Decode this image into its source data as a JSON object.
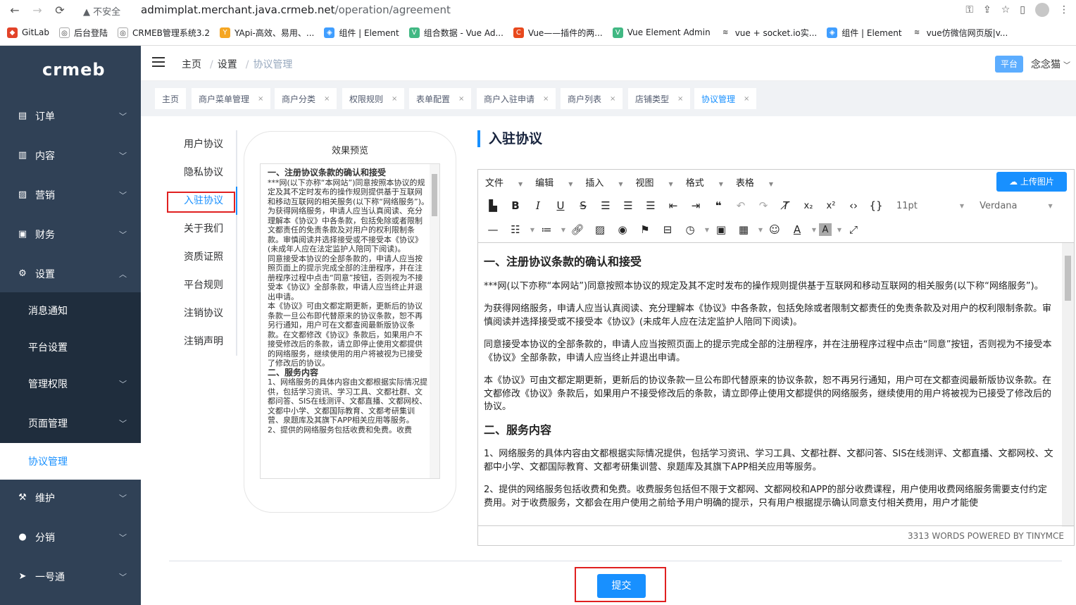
{
  "browser": {
    "insecure_label": "不安全",
    "url_host": "admimplat.merchant.java.crmeb.net",
    "url_path": "/operation/agreement",
    "bookmarks": [
      "GitLab",
      "后台登陆",
      "CRMEB管理系统3.2",
      "YApi-高效、易用、...",
      "组件 | Element",
      "组合数据 - Vue Ad...",
      "Vue——插件的两...",
      "Vue Element Admin",
      "vue + socket.io实...",
      "组件 | Element",
      "vue仿微信网页版|v..."
    ]
  },
  "sidebar": {
    "logo": "crmeb",
    "items": [
      {
        "label": "订单"
      },
      {
        "label": "内容"
      },
      {
        "label": "营销"
      },
      {
        "label": "财务"
      },
      {
        "label": "设置"
      },
      {
        "label": "维护"
      },
      {
        "label": "分销"
      },
      {
        "label": "一号通"
      }
    ],
    "sub_items": [
      {
        "label": "消息通知"
      },
      {
        "label": "平台设置"
      },
      {
        "label": "管理权限"
      },
      {
        "label": "页面管理"
      },
      {
        "label": "协议管理"
      }
    ]
  },
  "header": {
    "breadcrumb": [
      "主页",
      "设置",
      "协议管理"
    ],
    "platform_badge": "平台",
    "username": "念念猫"
  },
  "tabs": [
    "主页",
    "商户菜单管理",
    "商户分类",
    "权限规则",
    "表单配置",
    "商户入驻申请",
    "商户列表",
    "店铺类型",
    "协议管理"
  ],
  "agreement_tabs": [
    "用户协议",
    "隐私协议",
    "入驻协议",
    "关于我们",
    "资质证照",
    "平台规则",
    "注销协议",
    "注销声明"
  ],
  "preview": {
    "title": "效果预览",
    "h1": "一、注册协议条款的确认和接受",
    "p1": "***网(以下亦称“本网站”)同意按照本协议的规定及其不定时发布的操作规则提供基于互联网和移动互联网的相关服务(以下称“网络服务”)。",
    "p2": "为获得网络服务，申请人应当认真阅读、充分理解本《协议》中各条款，包括免除或者限制文都责任的免责条款及对用户的权利限制条款。审慎阅读并选择接受或不接受本《协议》(未成年人应在法定监护人陪同下阅读)。",
    "p3": "同意接受本协议的全部条款的，申请人应当按照页面上的提示完成全部的注册程序，并在注册程序过程中点击“同意”按钮，否则视为不接受本《协议》全部条款，申请人应当终止并退出申请。",
    "p4": "本《协议》可由文都定期更新，更新后的协议条款一旦公布即代替原来的协议条款，恕不再另行通知，用户可在文都查阅最新版协议条款。在文都修改《协议》条款后，如果用户不接受修改后的条款，请立即停止使用文都提供的网络服务，继续使用的用户将被视为已接受了修改后的协议。",
    "h2": "二、服务内容",
    "p5": "1、网络服务的具体内容由文都根据实际情况提供，包括学习资讯、学习工具、文都社群、文都问答、SIS在线测评、文都直播、文都网校、文都中小学、文都国际教育、文都考研集训营、泉题库及其旗下APP相关应用等服务。",
    "p6": "2、提供的网络服务包括收费和免费。收费"
  },
  "editor": {
    "title": "入驻协议",
    "menus": [
      "文件",
      "编辑",
      "插入",
      "视图",
      "格式",
      "表格"
    ],
    "upload_label": "上传图片",
    "font_size": "11pt",
    "font_family": "Verdana",
    "h1": "一、注册协议条款的确认和接受",
    "p1": "***网(以下亦称“本网站”)同意按照本协议的规定及其不定时发布的操作规则提供基于互联网和移动互联网的相关服务(以下称“网络服务”)。",
    "p2": "为获得网络服务，申请人应当认真阅读、充分理解本《协议》中各条款，包括免除或者限制文都责任的免责条款及对用户的权利限制条款。审慎阅读并选择接受或不接受本《协议》(未成年人应在法定监护人陪同下阅读)。",
    "p3": "同意接受本协议的全部条款的，申请人应当按照页面上的提示完成全部的注册程序，并在注册程序过程中点击“同意”按钮，否则视为不接受本《协议》全部条款，申请人应当终止并退出申请。",
    "p4": "本《协议》可由文都定期更新，更新后的协议条款一旦公布即代替原来的协议条款，恕不再另行通知，用户可在文都查阅最新版协议条款。在文都修改《协议》条款后，如果用户不接受修改后的条款，请立即停止使用文都提供的网络服务，继续使用的用户将被视为已接受了修改后的协议。",
    "h2": "二、服务内容",
    "p5": "1、网络服务的具体内容由文都根据实际情况提供，包括学习资讯、学习工具、文都社群、文都问答、SIS在线测评、文都直播、文都网校、文都中小学、文都国际教育、文都考研集训营、泉题库及其旗下APP相关应用等服务。",
    "p6": "2、提供的网络服务包括收费和免费。收费服务包括但不限于文都网、文都网校和APP的部分收费课程，用户使用收费网络服务需要支付约定费用。对于收费服务，文都会在用户使用之前给予用户明确的提示，只有用户根据提示确认同意支付相关费用，用户才能使",
    "status": "3313 WORDS POWERED BY TINYMCE"
  },
  "submit_label": "提交"
}
